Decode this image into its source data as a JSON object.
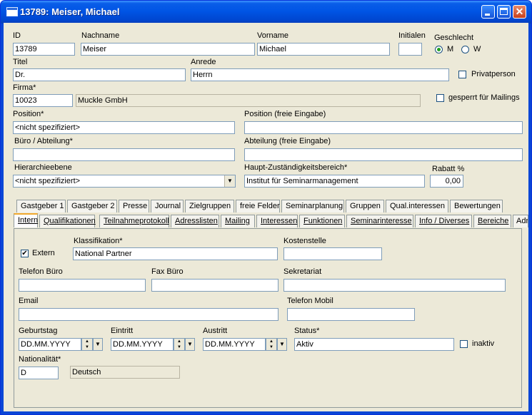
{
  "window": {
    "title": "13789: Meiser, Michael"
  },
  "header": {
    "id_label": "ID",
    "id_value": "13789",
    "nachname_label": "Nachname",
    "nachname_value": "Meiser",
    "vorname_label": "Vorname",
    "vorname_value": "Michael",
    "initialen_label": "Initialen",
    "initialen_value": "",
    "geschlecht_label": "Geschlecht",
    "geschlecht_m": "M",
    "geschlecht_w": "W",
    "geschlecht_selected": "M",
    "titel_label": "Titel",
    "titel_value": "Dr.",
    "anrede_label": "Anrede",
    "anrede_value": "Herrn",
    "privatperson_label": "Privatperson",
    "privatperson_checked": false,
    "firma_label": "Firma*",
    "firma_id": "10023",
    "firma_name": "Muckle GmbH",
    "gesperrt_label": "gesperrt für Mailings",
    "gesperrt_checked": false,
    "position_label": "Position*",
    "position_value": "<nicht spezifiziert>",
    "position_frei_label": "Position (freie Eingabe)",
    "position_frei_value": "",
    "buero_label": "Büro / Abteilung*",
    "buero_value": "",
    "abteilung_frei_label": "Abteilung (freie Eingabe)",
    "abteilung_frei_value": "",
    "hierarchie_label": "Hierarchieebene",
    "hierarchie_value": "<nicht spezifiziert>",
    "haupt_label": "Haupt-Zuständigkeitsbereich*",
    "haupt_value": "Institut für Seminarmanagement",
    "rabatt_label": "Rabatt %",
    "rabatt_value": "0,00"
  },
  "tabs_row1": [
    "Gastgeber 1",
    "Gastgeber 2",
    "Presse",
    "Journal",
    "Zielgruppen",
    "freie Felder",
    "Seminarplanung",
    "Gruppen",
    "Qual.interessen",
    "Bewertungen"
  ],
  "tabs_row2": [
    "Intern",
    "Qualifikationen",
    "Teilnahmeprotokoll",
    "Adresslisten",
    "Mailing",
    "Interessen",
    "Funktionen",
    "Seminarinteresse",
    "Info / Diverses",
    "Bereiche",
    "Adr"
  ],
  "active_tab": "Intern",
  "intern": {
    "extern_label": "Extern",
    "extern_checked": true,
    "klassifikation_label": "Klassifikation*",
    "klassifikation_value": "National Partner",
    "kostenstelle_label": "Kostenstelle",
    "kostenstelle_value": "",
    "telefon_buero_label": "Telefon Büro",
    "telefon_buero_value": "",
    "fax_buero_label": "Fax Büro",
    "fax_buero_value": "",
    "sekretariat_label": "Sekretariat",
    "sekretariat_value": "",
    "email_label": "Email",
    "email_value": "",
    "telefon_mobil_label": "Telefon Mobil",
    "telefon_mobil_value": "",
    "geburtstag_label": "Geburtstag",
    "geburtstag_value": "DD.MM.YYYY",
    "eintritt_label": "Eintritt",
    "eintritt_value": "DD.MM.YYYY",
    "austritt_label": "Austritt",
    "austritt_value": "DD.MM.YYYY",
    "status_label": "Status*",
    "status_value": "Aktiv",
    "inaktiv_label": "inaktiv",
    "inaktiv_checked": false,
    "nationalitaet_label": "Nationalität*",
    "nationalitaet_code": "D",
    "nationalitaet_name": "Deutsch"
  }
}
